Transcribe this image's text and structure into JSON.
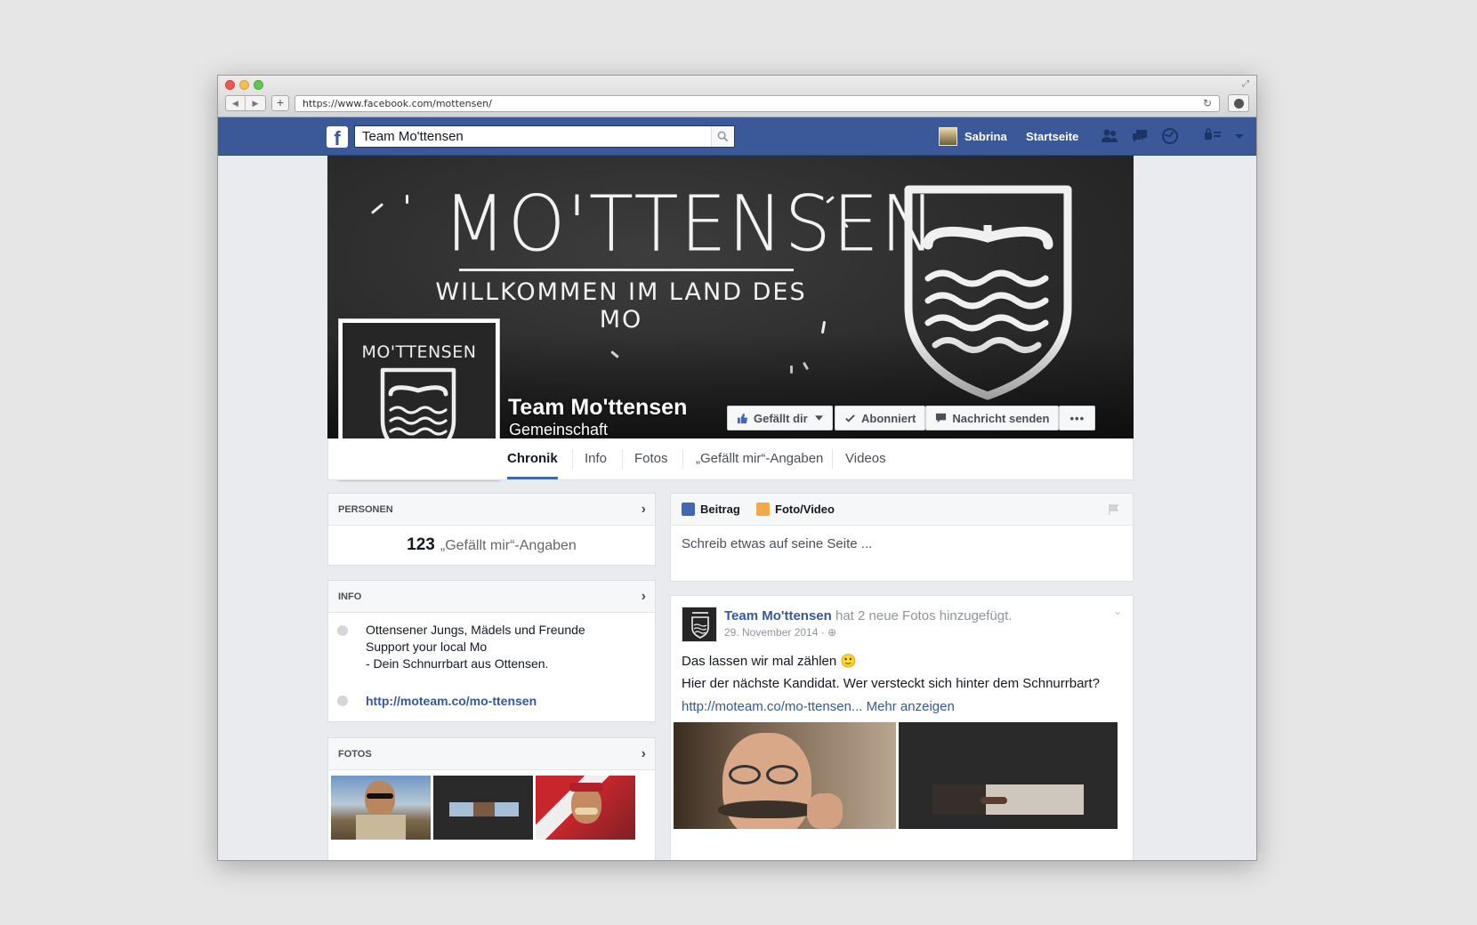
{
  "browser": {
    "url": "https://www.facebook.com/mottensen/"
  },
  "fb_header": {
    "search_value": "Team Mo'ttensen",
    "user_name": "Sabrina",
    "home_label": "Startseite"
  },
  "cover": {
    "title": "MO'TTENSEN",
    "subtitle": "WILLKOMMEN IM LAND DES MO",
    "profile_title": "MO'TTENSEN"
  },
  "page": {
    "name": "Team Mo'ttensen",
    "category": "Gemeinschaft"
  },
  "actions": {
    "like_label": "Gefällt dir",
    "follow_label": "Abonniert",
    "message_label": "Nachricht senden",
    "more_label": "•••"
  },
  "tabs": [
    {
      "label": "Chronik"
    },
    {
      "label": "Info"
    },
    {
      "label": "Fotos"
    },
    {
      "label": "„Gefällt mir“-Angaben"
    },
    {
      "label": "Videos"
    }
  ],
  "sidebar": {
    "people": {
      "heading": "PERSONEN",
      "likes_count": "123",
      "likes_label": "„Gefällt mir“-Angaben"
    },
    "info": {
      "heading": "INFO",
      "lines": [
        "Ottensener Jungs, Mädels und Freunde",
        "Support your local Mo",
        "- Dein Schnurrbart aus Ottensen."
      ],
      "link": "http://moteam.co/mo-ttensen"
    },
    "photos": {
      "heading": "FOTOS"
    }
  },
  "composer": {
    "tab_post": "Beitrag",
    "tab_photo": "Foto/Video",
    "placeholder": "Schreib etwas auf seine Seite ..."
  },
  "post": {
    "author": "Team Mo'ttensen",
    "action": "hat 2 neue Fotos hinzugefügt.",
    "date": "29. November 2014 ·",
    "line1": "Das lassen wir mal zählen 🙂",
    "line2": "Hier der nächste Kandidat. Wer versteckt sich hinter dem Schnurrbart?",
    "link": "http://moteam.co/mo-ttensen",
    "more": "... Mehr anzeigen"
  },
  "colors": {
    "facebook_blue": "#3b5998",
    "link_blue": "#365899",
    "cover_dark": "#2b2b2b"
  }
}
